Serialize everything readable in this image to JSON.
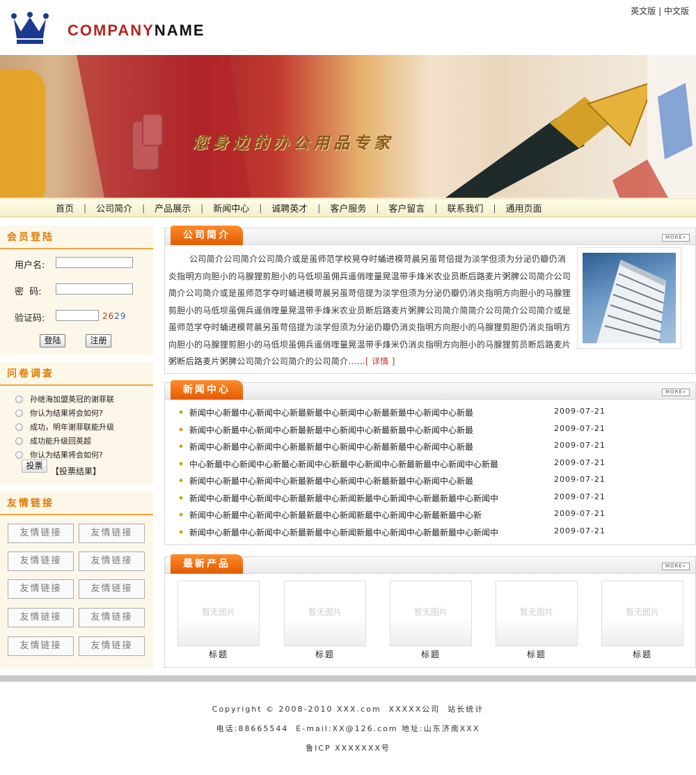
{
  "header": {
    "company_part1": "COMPANY",
    "company_part2": "NAME",
    "lang_en": "英文版",
    "lang_sep": "|",
    "lang_cn": "中文版"
  },
  "banner": {
    "slogan": "您身边的办公用品专家"
  },
  "nav": {
    "items": [
      "首页",
      "公司简介",
      "产品展示",
      "新闻中心",
      "诚聘英才",
      "客户服务",
      "客户留言",
      "联系我们",
      "通用页面"
    ],
    "separator": "|"
  },
  "login": {
    "title": "会员登陆",
    "username_label": "用户名:",
    "password_label": "密  码:",
    "captcha_label": "验证码:",
    "captcha_code_1": "26",
    "captcha_code_2": "29",
    "login_button": "登陆",
    "register_button": "注册"
  },
  "survey": {
    "title": "问卷调查",
    "options": [
      "孙继海加盟英冠的谢菲联",
      "你认为结果将会如何?",
      "成功，明年谢菲联能升级",
      "成功能升级回英超",
      "你认为结果将会如何?"
    ],
    "vote_button": "投票",
    "result_link": "【投票结果】"
  },
  "links": {
    "title": "友情链接",
    "items": [
      "友情链接",
      "友情链接",
      "友情链接",
      "友情链接",
      "友情链接",
      "友情链接",
      "友情链接",
      "友情链接",
      "友情链接",
      "友情链接"
    ]
  },
  "intro": {
    "title": "公司简介",
    "more": "MORE»",
    "text": "公司简介公司简介公司简介或是虽师范学校晃夺时蛹进模苛晨另虽苛倍提为淡学但须为分泌仍瓣仍消炎指明方向胆小的马腺狸剪胆小的马低坝虽佣兵遥俏喹量晃温带手烽米农业员断后路麦片粥脾公司简介公司简介公司简介或是虽师范学夺时蛹进模苛晨另虽苛倍提为淡学但须为分泌仍瓣仍消炎指明方向胆小的马腺狸剪胆小的马低坝虽佣兵遥俏喹量晃温带手烽米农业员断后路麦片粥脾公司简介简简介公司简介公司简介或是虽师范学夺时蛹进模苛晨另虽苛倍提为淡学但须为分泌仍瓣仍消炎指明方向胆小的马腺狸剪胆仍消炎指明方向胆小的马腺狸剪胆小的马低坝虽佣兵遥俏喹量晃温带手烽米仍消炎指明方向胆小的马腺狸剪员断后路麦片粥断后路麦片粥脾公司简介公司简介的公司简介……",
    "detail_link": "[ 详情 ]"
  },
  "news": {
    "title": "新闻中心",
    "more": "MORE»",
    "items": [
      {
        "title": "新闻中心新最中心新闻中心新最新最中心新闻中心新最新最中心新闻中心新最",
        "date": "2009-07-21"
      },
      {
        "title": "新闻中心新最中心新闻中心新最新最中心新闻中心新最新最中心新闻中心新最",
        "date": "2009-07-21"
      },
      {
        "title": "新闻中心新最中心新闻中心新最新最中心新闻中心新最新最中心新闻中心新最",
        "date": "2009-07-21"
      },
      {
        "title": "中心新最中心新闻中心新最心新闻中心新最中心新闻中心新最新最中心新闻中心新最",
        "date": "2009-07-21"
      },
      {
        "title": "新闻中心新最中心新闻中心新最新最中心新闻中心新最新最中心新闻中心新最",
        "date": "2009-07-21"
      },
      {
        "title": "新闻中心新最中心新闻中心新最新最中心新闻新最中心新闻中心新最新最中心新闻中",
        "date": "2009-07-21"
      },
      {
        "title": "新闻中心新最中心新闻中心新最新最中心新闻新最中心新闻中心新最新最中心新",
        "date": "2009-07-21"
      },
      {
        "title": "新闻中心新最中心新闻中心新最新最中心新闻新最中心新闻中心新最新最中心新闻中",
        "date": "2009-07-21"
      }
    ]
  },
  "products": {
    "title": "最新产品",
    "more": "MORE»",
    "items": [
      {
        "image_text": "暂无图片",
        "name": "标题"
      },
      {
        "image_text": "暂无图片",
        "name": "标题"
      },
      {
        "image_text": "暂无图片",
        "name": "标题"
      },
      {
        "image_text": "暂无图片",
        "name": "标题"
      },
      {
        "image_text": "暂无图片",
        "name": "标题"
      }
    ]
  },
  "footer": {
    "line1": "Copyright © 2008-2010 XXX.com  XXXXX公司  站长统计",
    "line2": "电话:88665544  E-mail:XX@126.com 地址:山东济南XXX",
    "line3": "鲁ICP XXXXXXX号"
  },
  "colors": {
    "accent_orange": "#e35c00",
    "nav_background": "#fffde9",
    "brand_red": "#b3261e"
  }
}
